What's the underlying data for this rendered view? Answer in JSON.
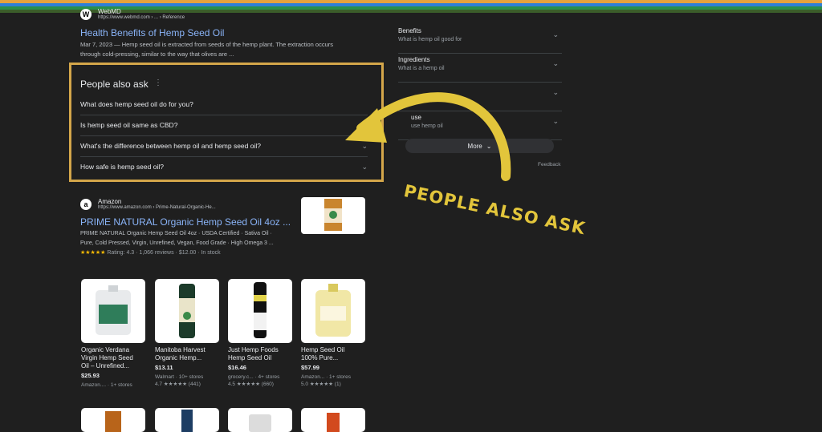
{
  "result1": {
    "site": "WebMD",
    "url": "https://www.webmd.com › ... › Reference",
    "title": "Health Benefits of Hemp Seed Oil",
    "snippet_line1": "Mar 7, 2023 — Hemp seed oil is extracted from seeds of the hemp plant. The extraction occurs",
    "snippet_line2": "through cold-pressing, similar to the way that olives are ..."
  },
  "paa": {
    "title": "People also ask",
    "questions": [
      "What does hemp seed oil do for you?",
      "Is hemp seed oil same as CBD?",
      "What's the difference between hemp oil and hemp seed oil?",
      "How safe is hemp seed oil?"
    ]
  },
  "sidebar": {
    "items": [
      {
        "title": "Benefits",
        "subtitle": "What is hemp oil good for"
      },
      {
        "title": "Ingredients",
        "subtitle": "What is a hemp oil"
      },
      {
        "title": "",
        "subtitle": ""
      },
      {
        "title": "use",
        "subtitle": "use hemp oil"
      }
    ],
    "more_label": "More",
    "feedback_label": "Feedback"
  },
  "result2": {
    "site": "Amazon",
    "url": "https://www.amazon.com › Prime-Natural-Organic-He...",
    "title": "PRIME NATURAL Organic Hemp Seed Oil 4oz ...",
    "snippet_line1": "PRIME NATURAL Organic Hemp Seed Oil 4oz · USDA Certified · Sativa Oil ·",
    "snippet_line2": "Pure, Cold Pressed, Virgin, Unrefined, Vegan, Food Grade · High Omega 3 ...",
    "rating_line": "Rating: 4.3 · 1,066 reviews · $12.00 · In stock"
  },
  "products": [
    {
      "name_line1": "Organic Verdana",
      "name_line2": "Virgin Hemp Seed",
      "name_line3": "Oil – Unrefined...",
      "price": "$25.93",
      "store": "Amazon.... · 1+ stores",
      "rating": ""
    },
    {
      "name_line1": "Manitoba Harvest",
      "name_line2": "Organic Hemp...",
      "name_line3": "",
      "price": "$13.11",
      "store": "Walmart · 10+ stores",
      "rating": "4.7 ★★★★★ (441)"
    },
    {
      "name_line1": "Just Hemp Foods",
      "name_line2": "Hemp Seed Oil",
      "name_line3": "",
      "price": "$16.46",
      "store": "grocery.c... · 4+ stores",
      "rating": "4.5 ★★★★★ (660)"
    },
    {
      "name_line1": "Hemp Seed Oil",
      "name_line2": "100% Pure...",
      "name_line3": "",
      "price": "$57.99",
      "store": "Amazon... · 1+ stores",
      "rating": "5.0 ★★★★★ (1)"
    }
  ],
  "overlay": {
    "text": "PEOPLE ALSO ASK",
    "color": "#e2c53b",
    "box_color": "#d4a64a"
  }
}
